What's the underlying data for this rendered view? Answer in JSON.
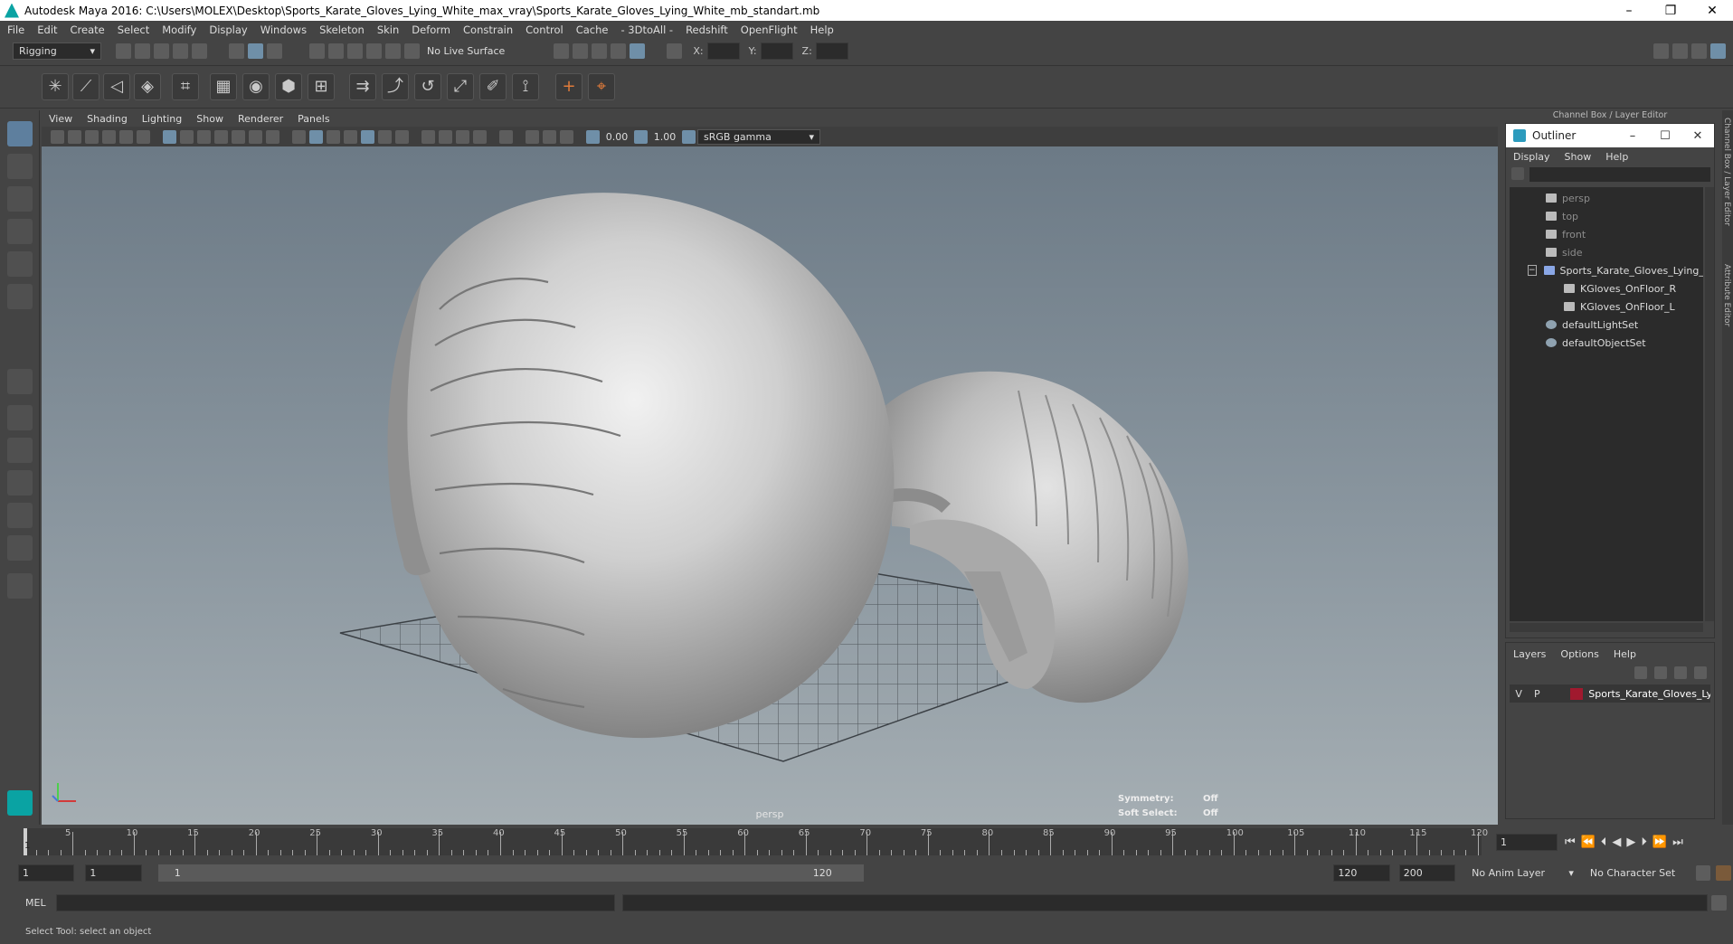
{
  "titlebar": {
    "title": "Autodesk Maya 2016: C:\\Users\\MOLEX\\Desktop\\Sports_Karate_Gloves_Lying_White_max_vray\\Sports_Karate_Gloves_Lying_White_mb_standart.mb",
    "minimize": "–",
    "restore": "❐",
    "close": "✕"
  },
  "menubar": [
    "File",
    "Edit",
    "Create",
    "Select",
    "Modify",
    "Display",
    "Windows",
    "Skeleton",
    "Skin",
    "Deform",
    "Constrain",
    "Control",
    "Cache",
    "- 3DtoAll -",
    "Redshift",
    "OpenFlight",
    "Help"
  ],
  "statusline": {
    "menuset": "Rigging",
    "live_surface": "No Live Surface",
    "x_label": "X:",
    "y_label": "Y:",
    "z_label": "Z:"
  },
  "panel_menu": [
    "View",
    "Shading",
    "Lighting",
    "Show",
    "Renderer",
    "Panels"
  ],
  "panel_toolbar": {
    "exposure": "0.00",
    "gamma": "1.00",
    "color_space": "sRGB gamma"
  },
  "viewport": {
    "camera": "persp",
    "symmetry_label": "Symmetry:",
    "symmetry_value": "Off",
    "soft_select_label": "Soft Select:",
    "soft_select_value": "Off"
  },
  "channelbox": {
    "header": "Channel Box / Layer Editor",
    "side_tab_1": "Channel Box / Layer Editor",
    "side_tab_2": "Attribute Editor"
  },
  "outliner": {
    "title": "Outliner",
    "minimize": "–",
    "maximize": "☐",
    "close": "✕",
    "menu": [
      "Display",
      "Show",
      "Help"
    ],
    "items": [
      {
        "label": "persp",
        "indent": 1,
        "icon": "camera-icon",
        "dim": true
      },
      {
        "label": "top",
        "indent": 1,
        "icon": "camera-icon",
        "dim": true
      },
      {
        "label": "front",
        "indent": 1,
        "icon": "camera-icon",
        "dim": true
      },
      {
        "label": "side",
        "indent": 1,
        "icon": "camera-icon",
        "dim": true
      },
      {
        "label": "Sports_Karate_Gloves_Lying_",
        "indent": 1,
        "icon": "group-icon",
        "dim": false
      },
      {
        "label": "KGloves_OnFloor_R",
        "indent": 2,
        "icon": "mesh-icon",
        "dim": false
      },
      {
        "label": "KGloves_OnFloor_L",
        "indent": 2,
        "icon": "mesh-icon",
        "dim": false
      },
      {
        "label": "defaultLightSet",
        "indent": 1,
        "icon": "set-icon",
        "dim": false
      },
      {
        "label": "defaultObjectSet",
        "indent": 1,
        "icon": "set-icon",
        "dim": false
      }
    ]
  },
  "layers": {
    "menu": [
      "Layers",
      "Options",
      "Help"
    ],
    "row": {
      "v": "V",
      "p": "P",
      "name": "Sports_Karate_Gloves_Lyin",
      "color": "#a0192e"
    }
  },
  "timeslider": {
    "ticks": [
      5,
      10,
      15,
      20,
      25,
      30,
      35,
      40,
      45,
      50,
      55,
      60,
      65,
      70,
      75,
      80,
      85,
      90,
      95,
      100,
      105,
      110,
      115,
      120
    ],
    "start": 1,
    "end": 120,
    "current_frame_label": "1",
    "current_frame": "1"
  },
  "range": {
    "start": "1",
    "anim_start": "1",
    "slider_start": "1",
    "slider_end": "120",
    "range_end": "120",
    "anim_end": "200",
    "anim_layer": "No Anim Layer",
    "character_set": "No Character Set"
  },
  "cmdline": {
    "label": "MEL"
  },
  "helpline": {
    "text": "Select Tool: select an object"
  },
  "colors": {
    "accent": "#5e7f9e",
    "layer": "#a0192e",
    "maya_logo": "#0aa3a3"
  }
}
